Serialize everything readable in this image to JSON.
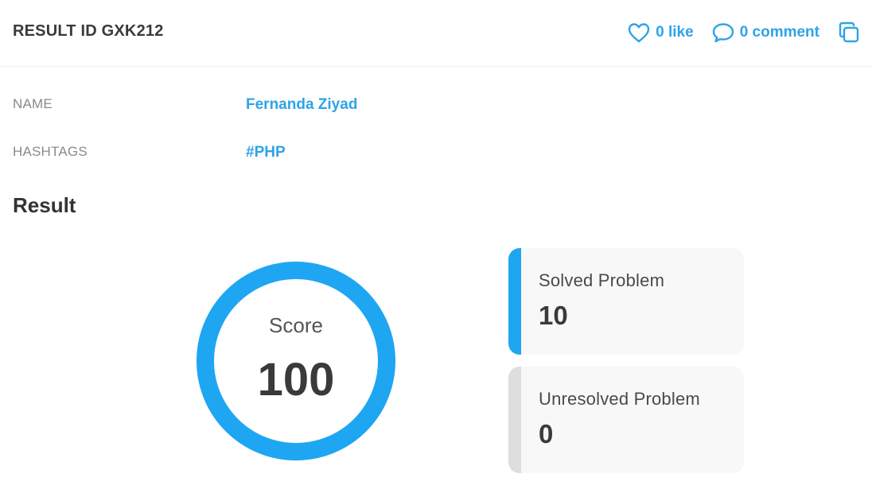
{
  "header": {
    "result_id": "RESULT ID GXK212",
    "like_label": "0 like",
    "comment_label": "0 comment",
    "copy_icon": "copy-icon"
  },
  "info": {
    "name_label": "NAME",
    "name_value": "Fernanda Ziyad",
    "hashtags_label": "HASHTAGS",
    "hashtags_value": "#PHP"
  },
  "result": {
    "title": "Result",
    "score_label": "Score",
    "score_value": "100",
    "score_progress": 1.0,
    "solved": {
      "label": "Solved Problem",
      "value": "10"
    },
    "unresolved": {
      "label": "Unresolved Problem",
      "value": "0"
    }
  },
  "colors": {
    "accent": "#2ea3e8",
    "ring": "#1ea6f3",
    "solved_bar": "#1ea6f3",
    "unresolved_bar": "#dedede",
    "card_bg": "#f8f8f8"
  }
}
